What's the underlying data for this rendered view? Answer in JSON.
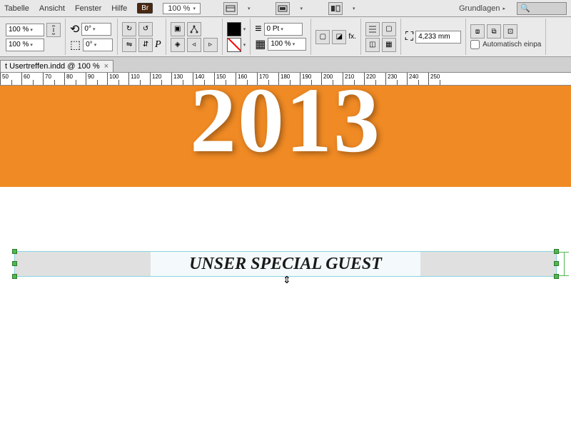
{
  "menu": {
    "items": [
      "Tabelle",
      "Ansicht",
      "Fenster",
      "Hilfe"
    ]
  },
  "top": {
    "br": "Br",
    "zoom": "100 %",
    "workspace": "Grundlagen"
  },
  "control": {
    "zoom1": "100 %",
    "zoom2": "100 %",
    "angle1": "0°",
    "angle2": "0°",
    "stroke": "0 Pt",
    "opacity": "100 %",
    "width": "4,233 mm",
    "auto_fit": "Automatisch einpa"
  },
  "tab": {
    "label": "t Usertreffen.indd @ 100 %",
    "close": "×"
  },
  "ruler": {
    "start": 50,
    "step": 10,
    "count": 21
  },
  "canvas": {
    "year": "2013",
    "heading": "UNSER SPECIAL GUEST"
  },
  "glyphs": {
    "p": "P",
    "fx": "fx.",
    "tri": "▾",
    "search": "🔍",
    "resize": "⇕"
  }
}
